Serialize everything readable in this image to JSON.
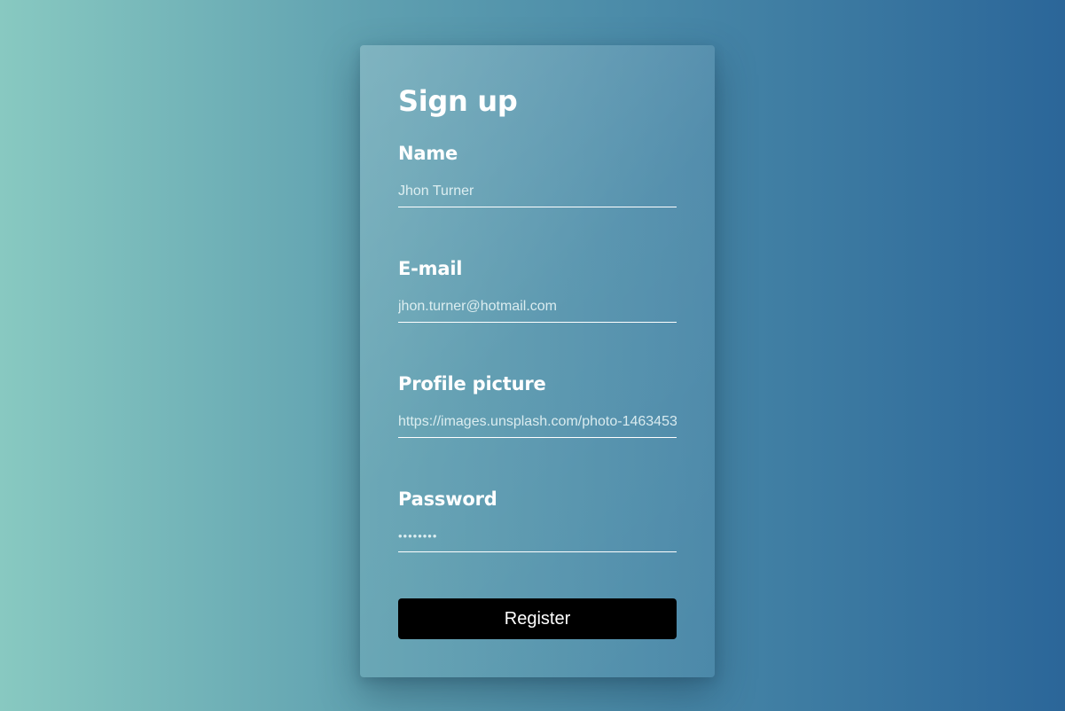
{
  "form": {
    "title": "Sign up",
    "fields": [
      {
        "label": "Name",
        "value": "Jhon Turner"
      },
      {
        "label": "E-mail",
        "value": "jhon.turner@hotmail.com"
      },
      {
        "label": "Profile picture",
        "value": "https://images.unsplash.com/photo-1463453"
      },
      {
        "label": "Password",
        "value": "••••••••"
      }
    ],
    "submit_label": "Register"
  },
  "colors": {
    "background_start": "#88c9c1",
    "background_end": "#2b6699",
    "text": "#ffffff",
    "button": "#000000"
  }
}
